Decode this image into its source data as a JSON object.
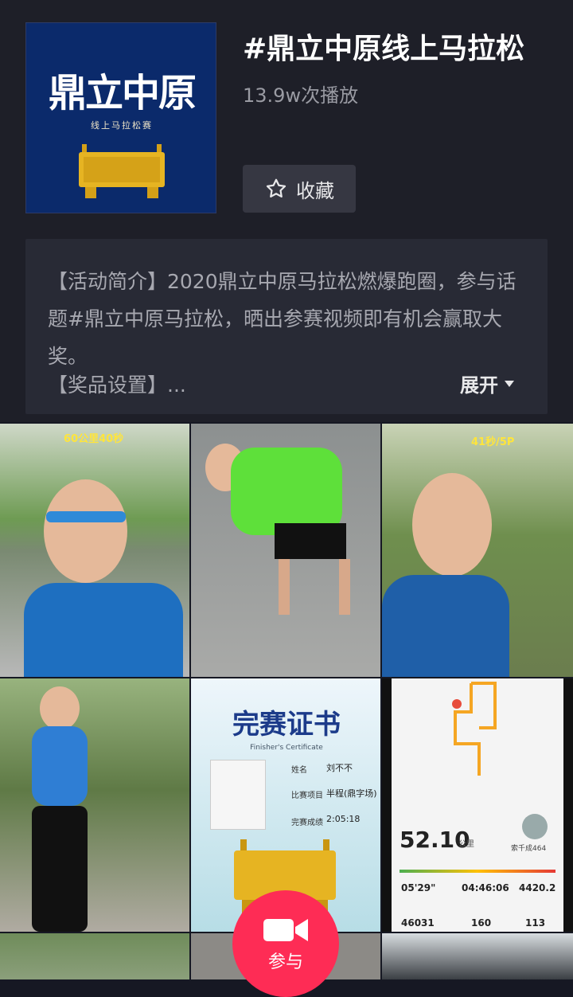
{
  "topic": {
    "title": "#鼎立中原线上马拉松",
    "plays": "13.9w次播放",
    "favorite_label": "收藏",
    "cover": {
      "title": "鼎立中原",
      "subtitle": "线上马拉松赛"
    }
  },
  "description": {
    "text": "【活动简介】2020鼎立中原马拉松燃爆跑圈，参与话题#鼎立中原马拉松，晒出参赛视频即有机会赢取大奖。",
    "more": "【奖品设置】...",
    "expand_label": "展开"
  },
  "videos": [
    {
      "overlay": "60公里40秒"
    },
    {
      "overlay": ""
    },
    {
      "overlay": "41秒/5P"
    },
    {
      "overlay": ""
    },
    {
      "cert_title": "完赛证书",
      "cert_subtitle": "Finisher's Certificate",
      "name_label": "姓名",
      "name_value": "刘不不",
      "event_label": "比赛项目",
      "event_value": "半程(鼎字场)",
      "time_label": "完赛成绩",
      "time_value": "2:05:18"
    },
    {
      "distance": "52.10",
      "distance_unit": "公里",
      "pace": "05'29\"",
      "duration": "04:46:06",
      "calories": "4420.2",
      "steps": "46031",
      "cadence": "160",
      "heart_rate": "113",
      "user": "索千成464"
    }
  ],
  "join": {
    "label": "参与"
  },
  "colors": {
    "accent": "#fe2c55",
    "background": "#161823",
    "panel": "#282a35"
  }
}
